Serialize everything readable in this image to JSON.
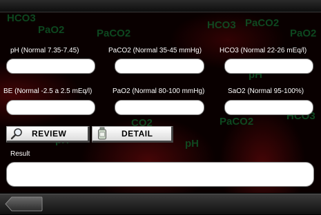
{
  "watermarks": [
    "HCO3",
    "PaO2",
    "PaCO2",
    "HCO3",
    "PaCO2",
    "PaO2",
    "pH",
    "pH",
    "PaCO2",
    "pH",
    "HCO3",
    "CO2"
  ],
  "fields": [
    {
      "label": "pH (Normal 7.35-7.45)",
      "value": ""
    },
    {
      "label": "PaCO2 (Normal 35-45 mmHg)",
      "value": ""
    },
    {
      "label": "HCO3 (Normal 22-26 mEq/l)",
      "value": ""
    },
    {
      "label": "BE (Normal -2.5 a 2.5 mEq/l)",
      "value": ""
    },
    {
      "label": "PaO2 (Normal 80-100 mmHg)",
      "value": ""
    },
    {
      "label": "SaO2 (Normal 95-100%)",
      "value": ""
    }
  ],
  "buttons": {
    "review": "REVIEW",
    "detail": "DETAIL"
  },
  "result": {
    "label": "Result",
    "value": ""
  },
  "icons": {
    "review": "magnifier-icon",
    "detail": "bottle-icon",
    "back": "back-arrow-icon"
  }
}
